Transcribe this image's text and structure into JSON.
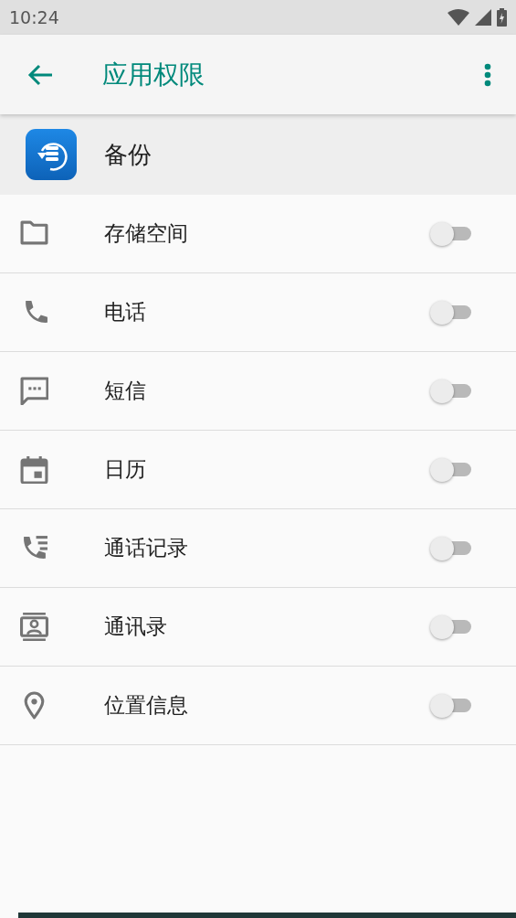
{
  "status_bar": {
    "time": "10:24"
  },
  "toolbar": {
    "title": "应用权限"
  },
  "app": {
    "name": "备份"
  },
  "permissions": [
    {
      "kind": "folder",
      "label": "存储空间",
      "on": false
    },
    {
      "kind": "phone",
      "label": "电话",
      "on": false
    },
    {
      "kind": "message",
      "label": "短信",
      "on": false
    },
    {
      "kind": "calendar",
      "label": "日历",
      "on": false
    },
    {
      "kind": "calllog",
      "label": "通话记录",
      "on": false
    },
    {
      "kind": "contacts",
      "label": "通讯录",
      "on": false
    },
    {
      "kind": "location",
      "label": "位置信息",
      "on": false
    }
  ]
}
